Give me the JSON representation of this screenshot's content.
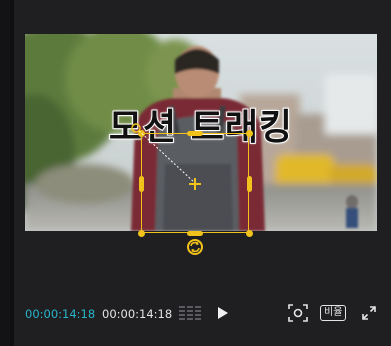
{
  "preview": {
    "caption": "모션 트래킹"
  },
  "player": {
    "current_time": "00:00:14:18",
    "total_time": "00:00:14:18",
    "ratio_label": "비율"
  },
  "colors": {
    "accent": "#f1c21b",
    "timecode_active": "#27b5c9"
  },
  "icons": [
    "grid-icon",
    "play-icon",
    "fit-to-screen-icon",
    "fullscreen-icon",
    "rotate-icon",
    "crosshair-icon"
  ]
}
